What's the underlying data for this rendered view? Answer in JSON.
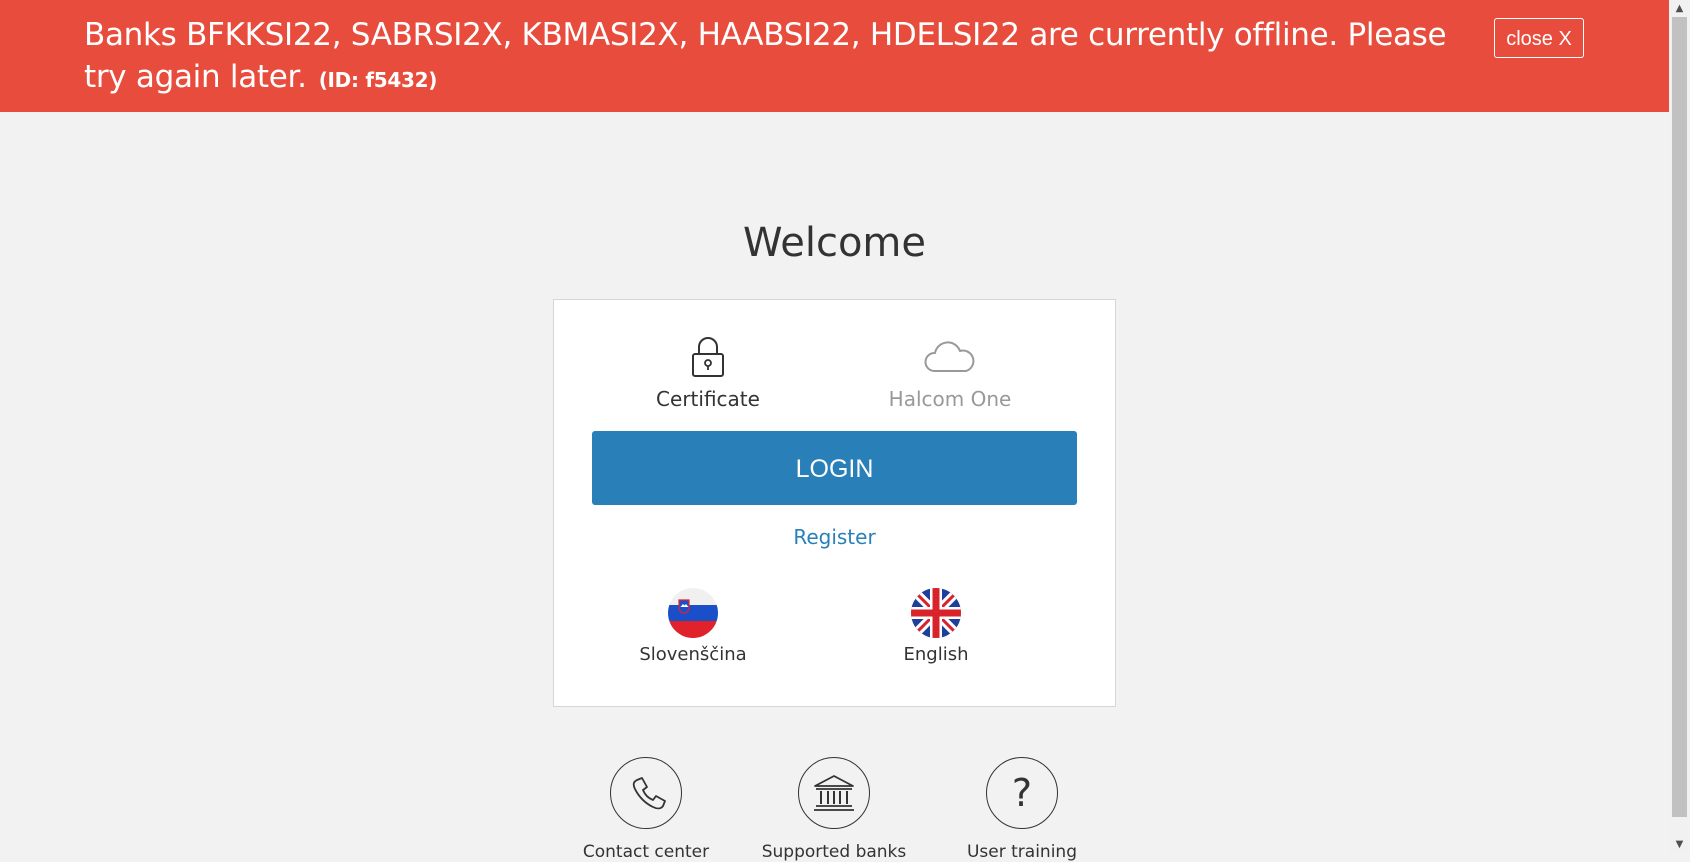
{
  "alert": {
    "message": "Banks BFKKSI22, SABRSI2X, KBMASI2X, HAABSI22, HDELSI22 are currently offline. Please try again later.",
    "id_label": "(ID: f5432)",
    "close_label": "close X",
    "background": "#e84c3d"
  },
  "page": {
    "welcome": "Welcome"
  },
  "login": {
    "methods": [
      {
        "label": "Certificate",
        "icon": "lock-icon"
      },
      {
        "label": "Halcom One",
        "icon": "cloud-icon"
      }
    ],
    "login_label": "LOGIN",
    "register_label": "Register",
    "accent": "#2980b9"
  },
  "languages": [
    {
      "label": "Slovenščina",
      "icon": "slovenia-flag-icon"
    },
    {
      "label": "English",
      "icon": "uk-flag-icon"
    }
  ],
  "footer": {
    "items": [
      {
        "label": "Contact center",
        "icon": "phone-icon"
      },
      {
        "label": "Supported banks",
        "icon": "bank-icon"
      },
      {
        "label": "User training",
        "icon": "question-icon"
      }
    ]
  }
}
